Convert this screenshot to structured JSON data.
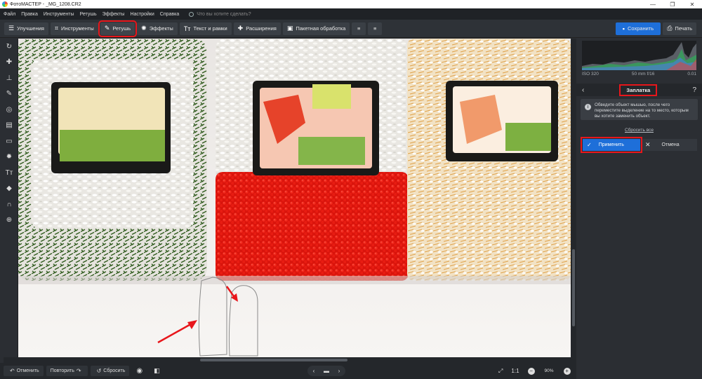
{
  "window": {
    "title": "ФотоМАСТЕР - _MG_1208.CR2",
    "controls": [
      "—",
      "❐",
      "✕"
    ]
  },
  "menu": {
    "items": [
      "Файл",
      "Правка",
      "Инструменты",
      "Ретушь",
      "Эффекты",
      "Настройки",
      "Справка"
    ],
    "search_placeholder": "Что вы хотите сделать?"
  },
  "toolbar": {
    "tabs": [
      {
        "label": "Улучшения",
        "icon": "sliders-icon"
      },
      {
        "label": "Инструменты",
        "icon": "crop-icon"
      },
      {
        "label": "Ретушь",
        "icon": "brush-icon",
        "active": true
      },
      {
        "label": "Эффекты",
        "icon": "magic-wand-icon"
      },
      {
        "label": "Текст и рамки",
        "icon": "text-icon"
      },
      {
        "label": "Расширения",
        "icon": "plus-icon"
      }
    ],
    "batch_label": "Пакетная обработка",
    "save_label": "Сохранить",
    "print_label": "Печать"
  },
  "left_tools": [
    "rotate-icon",
    "patch-icon",
    "stamp-icon",
    "brush-icon",
    "target-icon",
    "gradient-icon",
    "vignette-icon",
    "light-icon",
    "text-tool-icon",
    "fill-icon",
    "magnet-icon",
    "globe-icon"
  ],
  "histogram": {
    "iso": "ISO 320",
    "lens": "50 mm f/16",
    "shutter": "0.01"
  },
  "panel": {
    "title": "Заплатка",
    "hint": "Обведите объект мышью, после чего переместите выделение на то место, которым вы хотите заменить объект.",
    "reset_label": "Сбросить все",
    "apply_label": "Применить",
    "cancel_label": "Отмена"
  },
  "bottom": {
    "undo_label": "Отменить",
    "redo_label": "Повторить",
    "reset_label": "Сбросить",
    "ratio": "1:1",
    "zoom": "90%"
  },
  "colors": {
    "accent": "#1e6fd9",
    "highlight": "#e8161b"
  }
}
